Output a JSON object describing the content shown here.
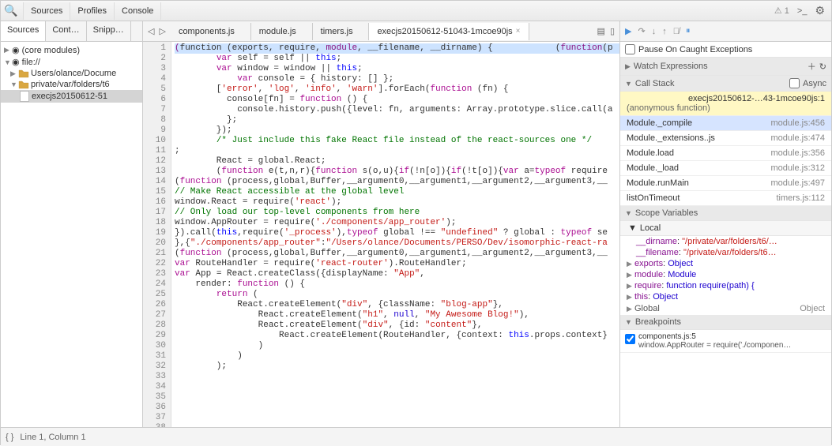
{
  "topbar": {
    "menus": [
      "Sources",
      "Profiles",
      "Console"
    ],
    "warn_count": "1"
  },
  "sidebar_tabs": [
    "Sources",
    "Cont…",
    "Snipp…"
  ],
  "file_tabs": [
    {
      "label": "components.js"
    },
    {
      "label": "module.js"
    },
    {
      "label": "timers.js"
    },
    {
      "label": "execjs20150612-51043-1mcoe90js",
      "active": true,
      "closable": true
    }
  ],
  "tree": {
    "core_modules": "(core modules)",
    "file": "file://",
    "folder1": "Users/olance/Docume",
    "folder2": "private/var/folders/t6",
    "file1": "execjs20150612-51"
  },
  "code_lines": [
    {
      "n": 1,
      "hl": true,
      "segs": [
        [
          "",
          ""
        ],
        [
          "(",
          "def"
        ],
        [
          "function",
          ""
        ],
        [
          " (exports, require, ",
          "plain"
        ],
        [
          "module",
          "def"
        ],
        [
          ", __filename, __dirname) {",
          "plain"
        ],
        [
          "            (",
          "plain"
        ],
        [
          "function",
          "def"
        ],
        [
          "(p",
          "plain"
        ]
      ]
    },
    {
      "n": 2,
      "segs": [
        [
          "        ",
          ""
        ],
        [
          "var",
          "keyword"
        ],
        [
          " self = self || ",
          "plain"
        ],
        [
          "this",
          "this"
        ],
        [
          ";",
          "plain"
        ]
      ]
    },
    {
      "n": 3,
      "segs": [
        [
          "        ",
          ""
        ],
        [
          "var",
          "keyword"
        ],
        [
          " window = window || ",
          "plain"
        ],
        [
          "this",
          "this"
        ],
        [
          ";",
          "plain"
        ]
      ]
    },
    {
      "n": 4,
      "segs": [
        [
          "            ",
          ""
        ],
        [
          "var",
          "keyword"
        ],
        [
          " console = { history: [] };",
          "plain"
        ]
      ]
    },
    {
      "n": 5,
      "segs": [
        [
          "        [",
          ""
        ],
        [
          "'error'",
          "str"
        ],
        [
          ", ",
          "plain"
        ],
        [
          "'log'",
          "str"
        ],
        [
          ", ",
          "plain"
        ],
        [
          "'info'",
          "str"
        ],
        [
          ", ",
          "plain"
        ],
        [
          "'warn'",
          "str"
        ],
        [
          "].forEach(",
          "plain"
        ],
        [
          "function",
          "keyword"
        ],
        [
          " (fn) {",
          "plain"
        ]
      ]
    },
    {
      "n": 6,
      "segs": [
        [
          "          console[fn] = ",
          ""
        ],
        [
          "function",
          "keyword"
        ],
        [
          " () {",
          "plain"
        ]
      ]
    },
    {
      "n": 7,
      "segs": [
        [
          "            console.history.push({level: fn, arguments: Array.prototype.slice.call(a",
          "plain"
        ]
      ]
    },
    {
      "n": 8,
      "segs": [
        [
          "          };",
          "plain"
        ]
      ]
    },
    {
      "n": 9,
      "segs": [
        [
          "        });",
          "plain"
        ]
      ]
    },
    {
      "n": 10,
      "segs": [
        [
          "",
          "plain"
        ]
      ]
    },
    {
      "n": 11,
      "segs": [
        [
          "        ",
          ""
        ],
        [
          "/* Just include this fake React file instead of the react-sources one */",
          "comment"
        ]
      ]
    },
    {
      "n": 12,
      "segs": [
        [
          ";",
          "plain"
        ]
      ]
    },
    {
      "n": 13,
      "segs": [
        [
          "        React = global.React;",
          "plain"
        ]
      ]
    },
    {
      "n": 14,
      "segs": [
        [
          "        (",
          ""
        ],
        [
          "function",
          "keyword"
        ],
        [
          " e(t,n,r){",
          "plain"
        ],
        [
          "function",
          "keyword"
        ],
        [
          " s(o,u){",
          "plain"
        ],
        [
          "if",
          "keyword"
        ],
        [
          "(!n[o]){",
          "plain"
        ],
        [
          "if",
          "keyword"
        ],
        [
          "(!t[o]){",
          "plain"
        ],
        [
          "var",
          "keyword"
        ],
        [
          " a=",
          "plain"
        ],
        [
          "typeof",
          "keyword"
        ],
        [
          " require",
          "plain"
        ]
      ]
    },
    {
      "n": 15,
      "segs": [
        [
          "(",
          ""
        ],
        [
          "function",
          "keyword"
        ],
        [
          " (process,global,Buffer,__argument0,__argument1,__argument2,__argument3,__",
          "plain"
        ]
      ]
    },
    {
      "n": 16,
      "segs": [
        [
          "// Make React accessible at the global level",
          "comment"
        ]
      ]
    },
    {
      "n": 17,
      "segs": [
        [
          "window.React = require(",
          ""
        ],
        [
          "'react'",
          "str"
        ],
        [
          ");",
          "plain"
        ]
      ]
    },
    {
      "n": 18,
      "segs": [
        [
          "",
          "plain"
        ]
      ]
    },
    {
      "n": 19,
      "segs": [
        [
          "// Only load our top-level components from here",
          "comment"
        ]
      ]
    },
    {
      "n": 20,
      "segs": [
        [
          "window.AppRouter = require(",
          ""
        ],
        [
          "'./components/app_router'",
          "str"
        ],
        [
          ");",
          "plain"
        ]
      ]
    },
    {
      "n": 21,
      "segs": [
        [
          "",
          "plain"
        ]
      ]
    },
    {
      "n": 22,
      "segs": [
        [
          "",
          "plain"
        ]
      ]
    },
    {
      "n": 23,
      "segs": [
        [
          "}).call(",
          ""
        ],
        [
          "this",
          "this"
        ],
        [
          ",require(",
          "plain"
        ],
        [
          "'_process'",
          "str"
        ],
        [
          "),",
          "plain"
        ],
        [
          "typeof",
          "keyword"
        ],
        [
          " global !== ",
          "plain"
        ],
        [
          "\"undefined\"",
          "str"
        ],
        [
          " ? global : ",
          "plain"
        ],
        [
          "typeof",
          "keyword"
        ],
        [
          " se",
          "plain"
        ]
      ]
    },
    {
      "n": 24,
      "segs": [
        [
          "},{",
          ""
        ],
        [
          "\"./components/app_router\"",
          "str"
        ],
        [
          ":",
          "plain"
        ],
        [
          "\"/Users/olance/Documents/PERSO/Dev/isomorphic-react-ra",
          "str"
        ]
      ]
    },
    {
      "n": 25,
      "segs": [
        [
          "(",
          ""
        ],
        [
          "function",
          "keyword"
        ],
        [
          " (process,global,Buffer,__argument0,__argument1,__argument2,__argument3,__",
          "plain"
        ]
      ]
    },
    {
      "n": 26,
      "segs": [
        [
          "var",
          "keyword"
        ],
        [
          " RouteHandler = require(",
          "plain"
        ],
        [
          "'react-router'",
          "str"
        ],
        [
          ").RouteHandler;",
          "plain"
        ]
      ]
    },
    {
      "n": 27,
      "segs": [
        [
          "",
          "plain"
        ]
      ]
    },
    {
      "n": 28,
      "segs": [
        [
          "var",
          "keyword"
        ],
        [
          " App = React.createClass({displayName: ",
          "plain"
        ],
        [
          "\"App\"",
          "str"
        ],
        [
          ",",
          "plain"
        ]
      ]
    },
    {
      "n": 29,
      "segs": [
        [
          "    render: ",
          ""
        ],
        [
          "function",
          "keyword"
        ],
        [
          " () {",
          "plain"
        ]
      ]
    },
    {
      "n": 30,
      "segs": [
        [
          "        ",
          ""
        ],
        [
          "return",
          "keyword"
        ],
        [
          " (",
          "plain"
        ]
      ]
    },
    {
      "n": 31,
      "segs": [
        [
          "            React.createElement(",
          ""
        ],
        [
          "\"div\"",
          "str"
        ],
        [
          ", {className: ",
          "plain"
        ],
        [
          "\"blog-app\"",
          "str"
        ],
        [
          "}, ",
          "plain"
        ]
      ]
    },
    {
      "n": 32,
      "segs": [
        [
          "                React.createElement(",
          ""
        ],
        [
          "\"h1\"",
          "str"
        ],
        [
          ", ",
          "plain"
        ],
        [
          "null",
          "num"
        ],
        [
          ", ",
          "plain"
        ],
        [
          "\"My Awesome Blog!\"",
          "str"
        ],
        [
          "), ",
          "plain"
        ]
      ]
    },
    {
      "n": 33,
      "segs": [
        [
          "",
          "plain"
        ]
      ]
    },
    {
      "n": 34,
      "segs": [
        [
          "                React.createElement(",
          ""
        ],
        [
          "\"div\"",
          "str"
        ],
        [
          ", {id: ",
          "plain"
        ],
        [
          "\"content\"",
          "str"
        ],
        [
          "}, ",
          "plain"
        ]
      ]
    },
    {
      "n": 35,
      "segs": [
        [
          "                    React.createElement(RouteHandler, {context: ",
          ""
        ],
        [
          "this",
          "this"
        ],
        [
          ".props.context}",
          "plain"
        ]
      ]
    },
    {
      "n": 36,
      "segs": [
        [
          "                )",
          "plain"
        ]
      ]
    },
    {
      "n": 37,
      "segs": [
        [
          "            )",
          "plain"
        ]
      ]
    },
    {
      "n": 38,
      "segs": [
        [
          "        );",
          "plain"
        ]
      ]
    }
  ],
  "status": "Line 1, Column 1",
  "pause_exceptions": "Pause On Caught Exceptions",
  "sections": {
    "watch": "Watch Expressions",
    "callstack": "Call Stack",
    "async": "Async",
    "scope": "Scope Variables",
    "breakpoints": "Breakpoints"
  },
  "callstack": [
    {
      "name": "execjs20150612-…43-1mcoe90js:1",
      "loc": "",
      "sub": "(anonymous function)",
      "active": true
    },
    {
      "name": "Module._compile",
      "loc": "module.js:456"
    },
    {
      "name": "Module._extensions..js",
      "loc": "module.js:474"
    },
    {
      "name": "Module.load",
      "loc": "module.js:356"
    },
    {
      "name": "Module._load",
      "loc": "module.js:312"
    },
    {
      "name": "Module.runMain",
      "loc": "module.js:497"
    },
    {
      "name": "listOnTimeout",
      "loc": "timers.js:112"
    }
  ],
  "scope": {
    "local": "Local",
    "items": [
      {
        "name": "__dirname",
        "val": "\"/private/var/folders/t6/…",
        "str": true
      },
      {
        "name": "__filename",
        "val": "\"/private/var/folders/t6…",
        "str": true
      },
      {
        "name": "exports",
        "val": "Object",
        "exp": true
      },
      {
        "name": "module",
        "val": "Module",
        "exp": true
      },
      {
        "name": "require",
        "val": "function require(path) {",
        "exp": true
      },
      {
        "name": "this",
        "val": "Object",
        "exp": true
      }
    ],
    "global": "Global",
    "global_val": "Object"
  },
  "breakpoint": {
    "loc": "components.js:5",
    "txt": "window.AppRouter = require('./componen…"
  }
}
